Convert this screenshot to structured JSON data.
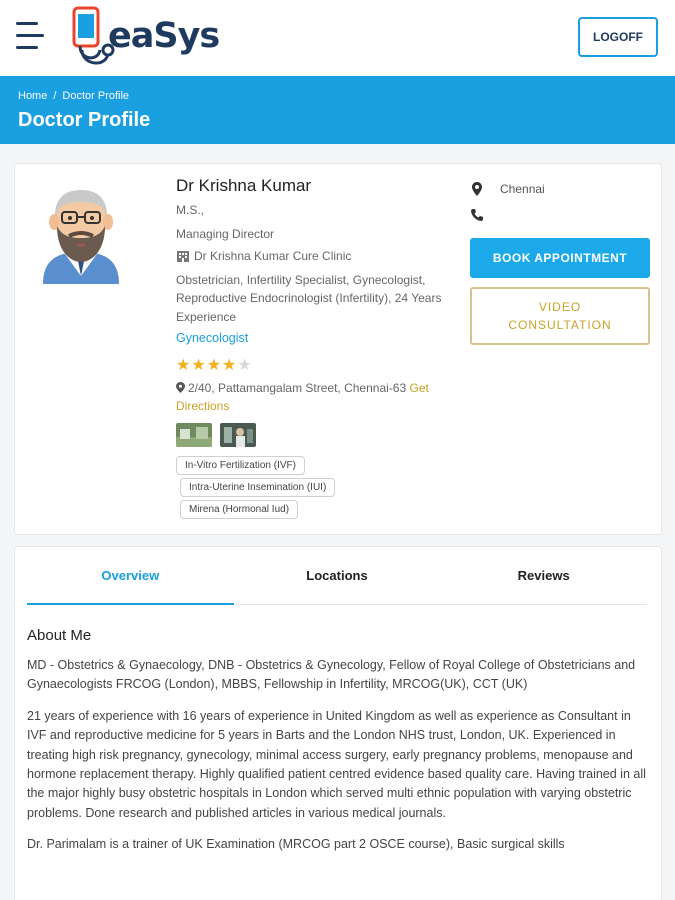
{
  "header": {
    "menu_icon": "hamburger-menu-icon",
    "logo_text": "eaSys",
    "logoff_label": "LOGOFF"
  },
  "banner": {
    "breadcrumb": [
      "Home",
      "Doctor Profile"
    ],
    "title": "Doctor Profile"
  },
  "doctor": {
    "name": "Dr Krishna Kumar",
    "degree": "M.S.,",
    "role": "Managing Director",
    "clinic": "Dr Krishna Kumar Cure Clinic",
    "specialities": "Obstetrician, Infertility Specialist, Gynecologist, Reproductive Endocrinologist (Infertility), 24 Years Experience",
    "specialty_link": "Gynecologist",
    "rating": 4,
    "rating_max": 5,
    "address": "2/40, Pattamangalam Street, Chennai-63",
    "directions_label": "Get Directions",
    "tags": [
      "In-Vitro Fertilization (IVF)",
      "Intra-Uterine Insemination (IUI)",
      "Mirena (Hormonal Iud)"
    ]
  },
  "contact": {
    "city": "Chennai",
    "phone": ""
  },
  "actions": {
    "book_label": "BOOK APPOINTMENT",
    "video_label": "VIDEO CONSULTATION"
  },
  "tabs": [
    {
      "label": "Overview",
      "active": true
    },
    {
      "label": "Locations",
      "active": false
    },
    {
      "label": "Reviews",
      "active": false
    }
  ],
  "about": {
    "heading": "About Me",
    "paragraphs": [
      "MD - Obstetrics & Gynaecology, DNB - Obstetrics & Gynecology, Fellow of Royal College of Obstetricians and Gynaecologists FRCOG (London), MBBS, Fellowship in Infertility, MRCOG(UK), CCT (UK)",
      "21 years of experience with 16 years of experience in United Kingdom as well as experience as Consultant in IVF and reproductive medicine for 5 years in Barts and the London NHS trust, London, UK. Experienced in treating high risk pregnancy, gynecology, minimal access surgery, early pregnancy problems, menopause and hormone replacement therapy. Highly qualified patient centred evidence based quality care. Having trained in all the major highly busy obstetric hospitals in London which served multi ethnic population with varying obstetric problems. Done research and published articles in various medical journals.",
      "Dr. Parimalam is a trainer of UK Examination (MRCOG part 2 OSCE course), Basic surgical skills"
    ]
  },
  "colors": {
    "primary": "#1a9fe0",
    "navy": "#1f3a5f",
    "gold": "#c9a227",
    "star": "#f2b01e"
  }
}
